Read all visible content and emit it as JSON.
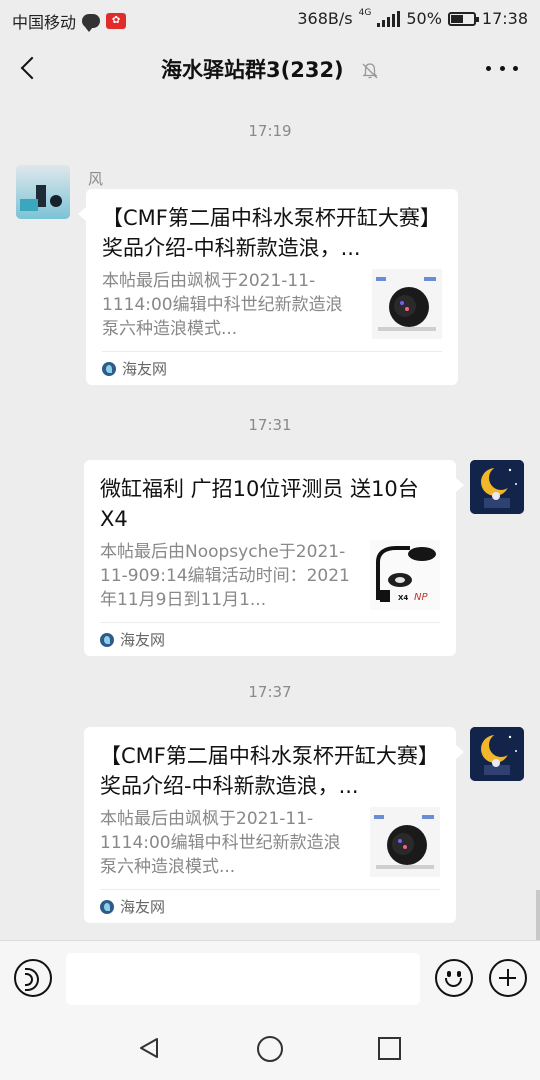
{
  "status_bar": {
    "carrier": "中国移动",
    "network_speed": "368B/s",
    "network_type": "4G",
    "battery": "50%",
    "time": "17:38"
  },
  "header": {
    "title": "海水驿站群3(232)"
  },
  "messages": [
    {
      "time": "17:19",
      "sender": "风",
      "side": "left",
      "card": {
        "title": "【CMF第二届中科水泵杯开缸大赛】奖品介绍-中科新款造浪，...",
        "desc": "本帖最后由飒枫于2021-11-1114:00编辑中科世纪新款造浪泵六种造浪模式...",
        "source": "海友网"
      }
    },
    {
      "time": "17:31",
      "side": "right",
      "card": {
        "title": "微缸福利  广招10位评测员  送10台X4",
        "desc": "本帖最后由Noopsyche于2021-11-909:14编辑活动时间：2021年11月9日到11月1...",
        "source": "海友网"
      }
    },
    {
      "time": "17:37",
      "side": "right",
      "card": {
        "title": "【CMF第二届中科水泵杯开缸大赛】奖品介绍-中科新款造浪，...",
        "desc": "本帖最后由飒枫于2021-11-1114:00编辑中科世纪新款造浪泵六种造浪模式...",
        "source": "海友网"
      }
    }
  ],
  "thumb_text": {
    "x4": "X4",
    "brand": "NP"
  },
  "input": {
    "value": ""
  },
  "colors": {
    "background": "#ededed",
    "card": "#ffffff",
    "muted_text": "#888888"
  }
}
